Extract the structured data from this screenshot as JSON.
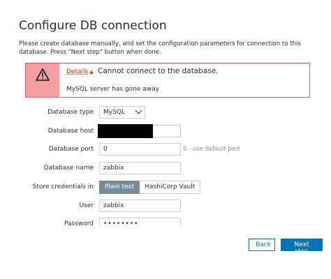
{
  "page": {
    "title": "Configure DB connection",
    "description": "Please create database manually, and set the configuration parameters for connection to this database. Press \"Next step\" button when done."
  },
  "error": {
    "details_label": "Details",
    "details_arrow": "▲",
    "message": "Cannot connect to the database.",
    "detail_text": "MySQL server has gone away"
  },
  "form": {
    "db_type_label": "Database type",
    "db_type_value": "MySQL",
    "db_host_label": "Database host",
    "db_host_value": "",
    "db_port_label": "Database port",
    "db_port_value": "0",
    "db_port_hint": "0 - use default port",
    "db_name_label": "Database name",
    "db_name_value": "zabbix",
    "store_label": "Store credentials in",
    "store_options": [
      "Plain text",
      "HashiCorp Vault"
    ],
    "store_selected": "Plain text",
    "user_label": "User",
    "user_value": "zabbix",
    "password_label": "Password",
    "password_value": "••••••••"
  },
  "buttons": {
    "back": "Back",
    "next": "Next step"
  },
  "colors": {
    "accent": "#0275b8",
    "error": "#e45959",
    "error_icon_bg": "#f5a0a0",
    "toggle_on": "#768d99"
  },
  "icons": {
    "warning": "warning-icon",
    "chevron": "chevron-down-icon"
  }
}
